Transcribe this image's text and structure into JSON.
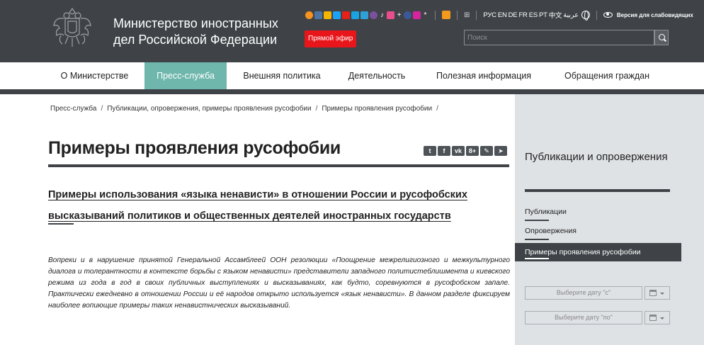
{
  "header": {
    "ministry_name": "Министерство иностранных дел Российской Федерации",
    "live_label": "Прямой эфир",
    "social_icons": [
      "odnoklassniki-icon",
      "vk-icon",
      "livejournal-icon",
      "twitter-icon",
      "youtube-icon",
      "photo-icon",
      "telegram-icon",
      "viber-icon",
      "tiktok-icon",
      "rutube-icon",
      "plus-icon",
      "facebook-icon",
      "instagram-icon",
      "star-icon"
    ],
    "languages": [
      "РУС",
      "EN",
      "DE",
      "FR",
      "ES",
      "PT",
      "中文",
      "عربية"
    ],
    "vision_label": "Версия для слабовидящих",
    "search_placeholder": "Поиск"
  },
  "nav": {
    "items": [
      "О Министерстве",
      "Пресс-служба",
      "Внешняя политика",
      "Деятельность",
      "Полезная информация",
      "Обращения граждан"
    ],
    "active_index": 1
  },
  "breadcrumb": [
    "Пресс-служба",
    "Публикации, опровержения, примеры проявления русофобии",
    "Примеры проявления русофобии"
  ],
  "breadcrumb_separator": "/",
  "main": {
    "title": "Примеры проявления русофобии",
    "share_icons": [
      "twitter-icon",
      "facebook-icon",
      "vk-icon",
      "google-plus-icon",
      "link-icon",
      "telegram-icon"
    ],
    "share_glyphs": [
      "t",
      "f",
      "vk",
      "8+",
      "✎",
      "➤"
    ],
    "subtitle": "Примеры использования «языка ненависти» в отношении России и русофобских высказываний политиков и общественных деятелей иностранных государств",
    "body": "Вопреки и в нарушение принятой Генеральной Ассамблеей ООН резолюции «Поощрение межрелигиозного и межкультурного диалога и толерантности в контексте борьбы с языком ненависти» представители западного политистеблишмента и киевского режима из года в год в своих публичных выступлениях и высказываниях, как будто, соревнуются в русофобском запале. Практически ежедневно в отношении России и её народов открыто используется «язык ненависти». В данном разделе фиксируем наиболее вопиющие примеры таких ненавистнических высказываний."
  },
  "sidebar": {
    "title": "Публикации и опровержения",
    "links": [
      "Публикации",
      "Опровержения",
      "Примеры проявления русофобии"
    ],
    "active_index": 2,
    "date_from": "Выберите дату \"с\"",
    "date_to": "Выберите дату \"по\""
  },
  "colors": {
    "header_bg": "#3f4347",
    "nav_active": "#6fb7ac",
    "live_red": "#e8161b",
    "sidebar_bg": "#dfe2e5"
  }
}
